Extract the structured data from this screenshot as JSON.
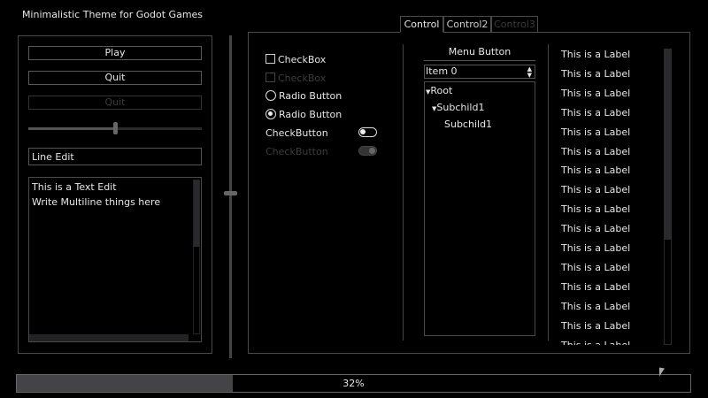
{
  "title": "Minimalistic Theme for Godot Games",
  "left": {
    "play": "Play",
    "quit": "Quit",
    "quit_disabled": "Quit",
    "slider_value": 50,
    "line_edit": "Line Edit",
    "text_edit": [
      "This is a Text Edit",
      "Write Multiline things here"
    ]
  },
  "vslider_value": 50,
  "tabs": [
    {
      "label": "Control"
    },
    {
      "label": "Control2"
    },
    {
      "label": "Control3"
    }
  ],
  "controls": {
    "checkbox": "CheckBox",
    "checkbox_disabled": "CheckBox",
    "radio1": "Radio Button",
    "radio2": "Radio Button",
    "check_button": "CheckButton",
    "check_button_disabled": "CheckButton"
  },
  "menu": {
    "label": "Menu Button",
    "option": "Item 0",
    "tree": {
      "root": "Root",
      "child": "Subchild1",
      "grandchild": "Subchild1"
    }
  },
  "labels": [
    "This is a Label",
    "This is a Label",
    "This is a Label",
    "This is a Label",
    "This is a Label",
    "This is a Label",
    "This is a Label",
    "This is a Label",
    "This is a Label",
    "This is a Label",
    "This is a Label",
    "This is a Label",
    "This is a Label",
    "This is a Label",
    "This is a Label",
    "This is a Label"
  ],
  "progress": {
    "value": 32,
    "text": "32%"
  }
}
